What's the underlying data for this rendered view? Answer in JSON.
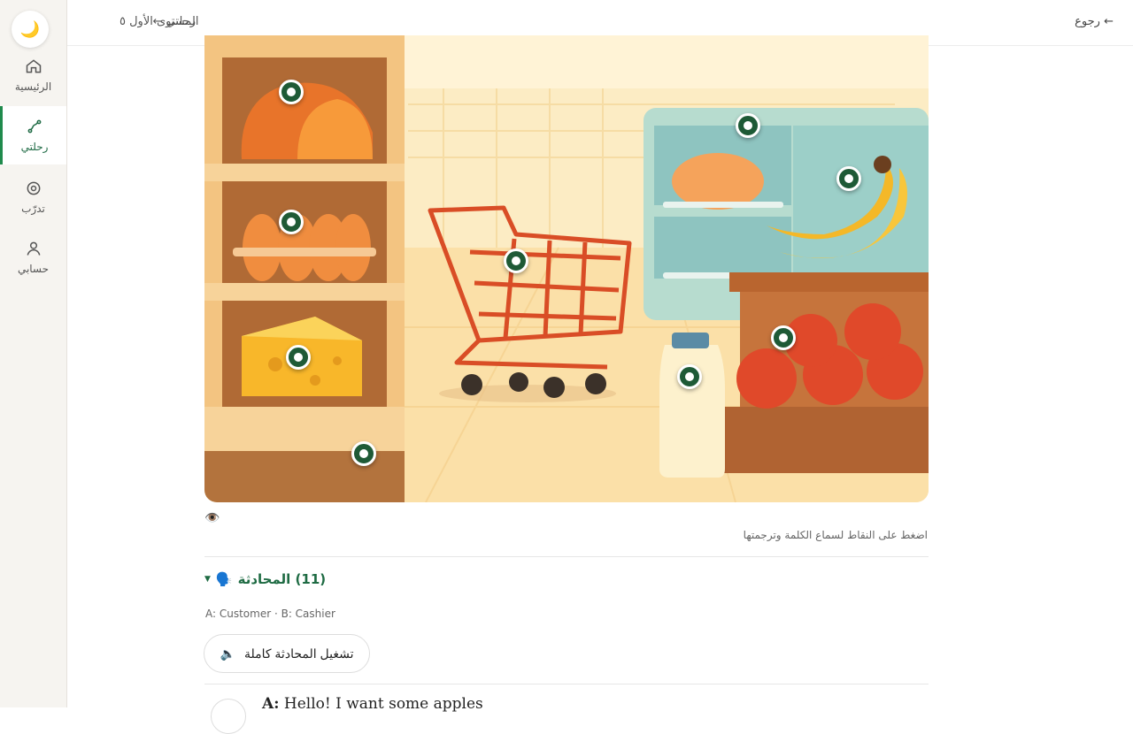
{
  "sidebar": {
    "theme_icon": "moon-icon",
    "items": [
      {
        "label": "الرئيسية",
        "icon": "home-icon"
      },
      {
        "label": "رحلتي",
        "icon": "route-icon",
        "active": true
      },
      {
        "label": "تدرّب",
        "icon": "target-icon"
      },
      {
        "label": "حسابي",
        "icon": "user-icon"
      }
    ]
  },
  "topbar": {
    "back_label": "رجوع ←",
    "breadcrumb_level": "المستوى الأول ٥",
    "breadcrumb_journey": "رحلتي ←"
  },
  "scene": {
    "hotspot_count": 10
  },
  "vocab_hint": "اضغط على النقاط لسماع الكلمة وترجمتها",
  "conversation": {
    "title": "(11) المحادثة",
    "roles": "A: Customer · B: Cashier",
    "play_all_label": "تشغيل المحادثة كاملة",
    "first_line_speaker": "A:",
    "first_line_text": "Hello! I want some apples"
  },
  "colors": {
    "accent": "#1e6b43",
    "hotspot": "#1e5a36",
    "sidebar_bg": "#f6f4f0"
  }
}
